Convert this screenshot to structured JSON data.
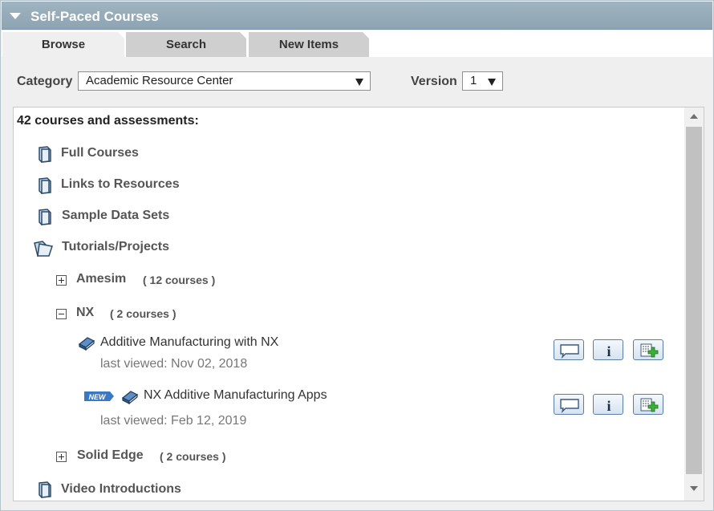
{
  "panel": {
    "title": "Self-Paced Courses"
  },
  "tabs": [
    {
      "label": "Browse"
    },
    {
      "label": "Search"
    },
    {
      "label": "New Items"
    }
  ],
  "filters": {
    "category_label": "Category",
    "category_value": "Academic Resource Center",
    "version_label": "Version",
    "version_value": "1"
  },
  "list": {
    "count_text": "42 courses and assessments:",
    "categories": [
      {
        "label": "Full Courses",
        "icon": "folder-closed-icon"
      },
      {
        "label": "Links to Resources",
        "icon": "folder-closed-icon"
      },
      {
        "label": "Sample Data Sets",
        "icon": "folder-closed-icon"
      },
      {
        "label": "Tutorials/Projects",
        "icon": "folder-open-icon"
      },
      {
        "label": "Video Introductions",
        "icon": "folder-closed-icon"
      }
    ],
    "subcategories": [
      {
        "label": "Amesim",
        "count": "( 12 courses )",
        "state": "collapsed"
      },
      {
        "label": "NX",
        "count": "( 2 courses )",
        "state": "expanded"
      },
      {
        "label": "Solid Edge",
        "count": "( 2 courses )",
        "state": "collapsed"
      }
    ],
    "courses": [
      {
        "title": "Additive Manufacturing with NX",
        "last_viewed": "last viewed: Nov 02, 2018",
        "is_new": false
      },
      {
        "title": "NX Additive Manufacturing Apps",
        "last_viewed": "last viewed: Feb 12, 2019",
        "is_new": true,
        "badge": "NEW"
      }
    ]
  },
  "colors": {
    "header_bg": "#9fb3c0",
    "badge_blue": "#3b78c4",
    "action_border": "#5a7da6"
  }
}
